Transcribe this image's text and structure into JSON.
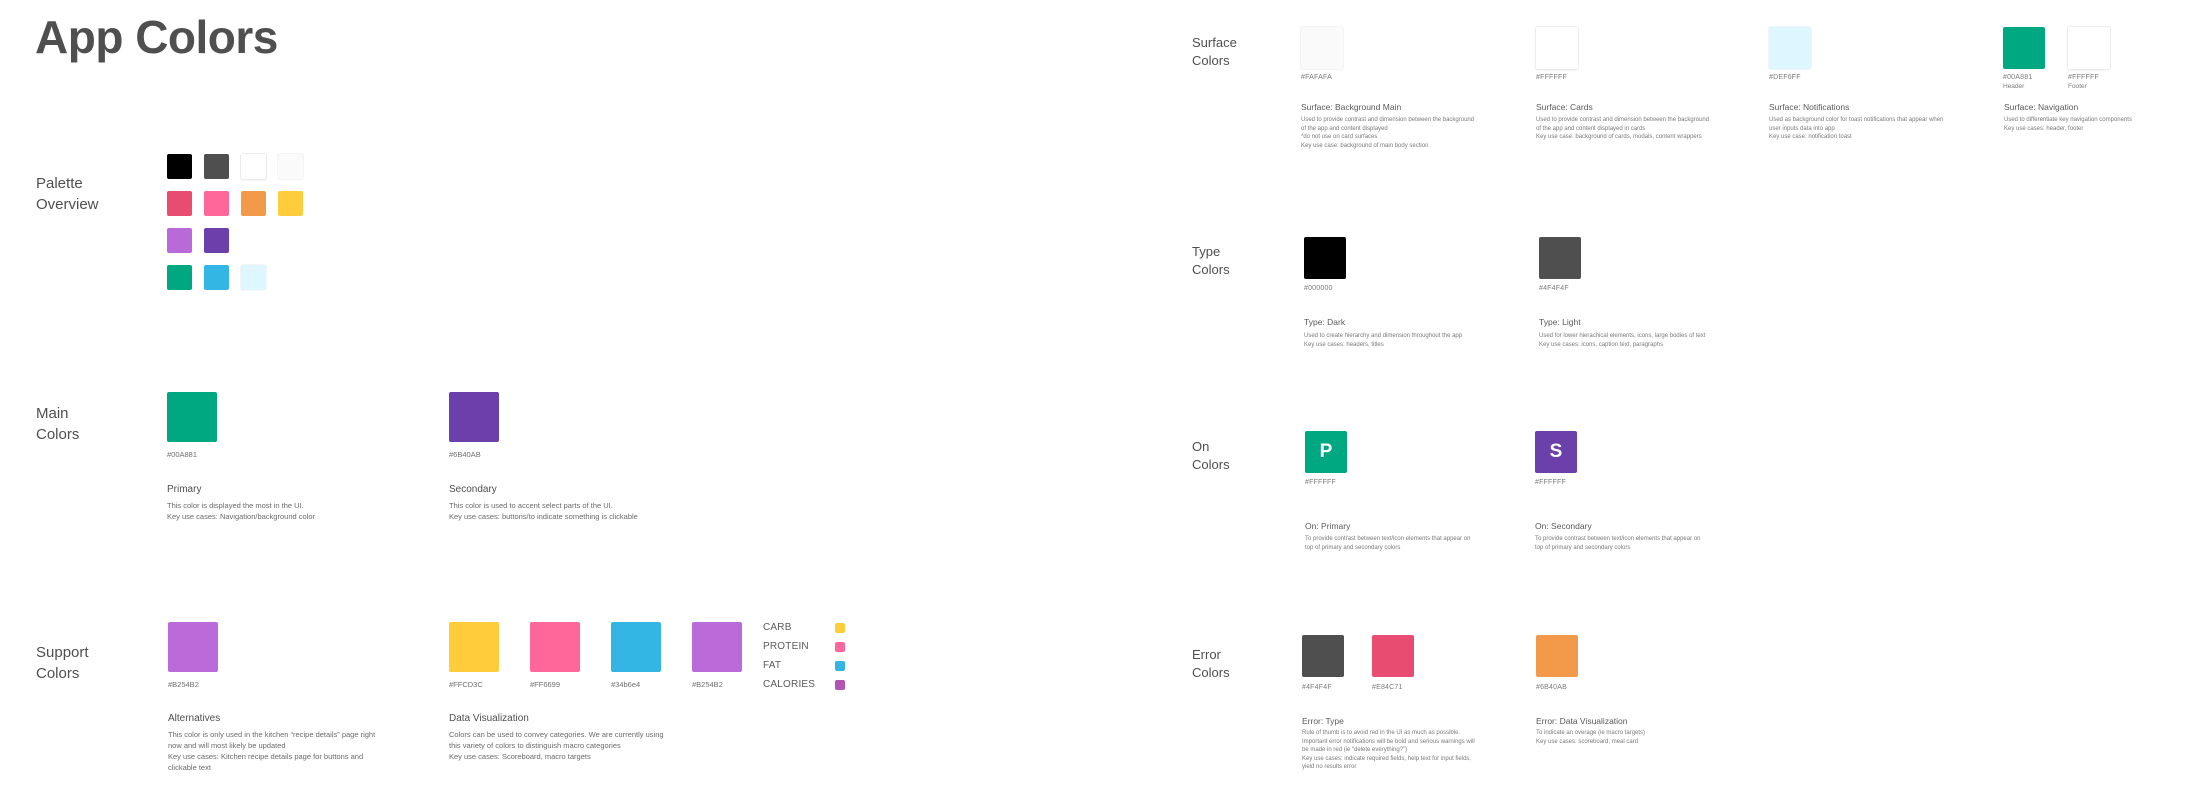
{
  "page": {
    "title": "App Colors"
  },
  "palette": {
    "label": [
      "Palette",
      "Overview"
    ],
    "rows": [
      [
        {
          "hex": "#000000"
        },
        {
          "hex": "#4F4F4F"
        },
        {
          "hex": "#FFFFFF"
        },
        {
          "hex": "#FAFAFA"
        }
      ],
      [
        {
          "hex": "#E84C71"
        },
        {
          "hex": "#FF6699"
        },
        {
          "hex": "#F39A4A"
        },
        {
          "hex": "#FFCD3C"
        }
      ],
      [
        {
          "hex": "#B86AD9"
        },
        {
          "hex": "#6B40AB"
        }
      ],
      [
        {
          "hex": "#00A881"
        },
        {
          "hex": "#34B6E4"
        },
        {
          "hex": "#DEF6FF"
        }
      ]
    ]
  },
  "main": {
    "label": [
      "Main",
      "Colors"
    ],
    "items": [
      {
        "hex_label": "#00A881",
        "color": "#00A881",
        "title": "Primary",
        "desc": [
          "This color is displayed the most in the UI.",
          "Key use cases: Navigation/background color"
        ]
      },
      {
        "hex_label": "#6B40AB",
        "color": "#6B40AB",
        "title": "Secondary",
        "desc": [
          "This color is used to accent select parts of the UI.",
          "Key use cases: buttons/to indicate something is clickable"
        ]
      }
    ]
  },
  "support": {
    "label": [
      "Support",
      "Colors"
    ],
    "alternatives": {
      "hex_label": "#B254B2",
      "color": "#BA6BD9",
      "title": "Alternatives",
      "desc": [
        "This color is only used in the kitchen “recipe details” page right",
        "now and will most likely be updated",
        "Key use cases: Kitchen recipe details page for buttons and",
        "clickable text"
      ]
    },
    "data_viz": {
      "swatches": [
        {
          "hex_label": "#FFCD3C",
          "color": "#FFCD3C"
        },
        {
          "hex_label": "#FF6699",
          "color": "#FF6699"
        },
        {
          "hex_label": "#34b6e4",
          "color": "#34B6E4"
        },
        {
          "hex_label": "#B254B2",
          "color": "#BA6BD9"
        }
      ],
      "legend": [
        {
          "label": "CARB",
          "color": "#FFCD3C"
        },
        {
          "label": "PROTEIN",
          "color": "#FF6699"
        },
        {
          "label": "FAT",
          "color": "#34B6E4"
        },
        {
          "label": "CALORIES",
          "color": "#B254B2"
        }
      ],
      "title": "Data Visualization",
      "desc": [
        "Colors can be used to convey categories. We are currently using",
        "this variety of colors to distinguish macro categories",
        "Key use cases: Scoreboard, macro targets"
      ]
    }
  },
  "surface": {
    "label": [
      "Surface",
      "Colors"
    ],
    "items": [
      {
        "hex_label": "#FAFAFA",
        "color": "#FAFAFA",
        "title": "Surface: Background Main",
        "desc": [
          "Used to provide contrast and dimension between the background",
          "of the app and content displayed",
          "*do not use on card surfaces",
          "Key use case: background of main body section"
        ]
      },
      {
        "hex_label": "#FFFFFF",
        "color": "#FFFFFF",
        "title": "Surface: Cards",
        "desc": [
          "Used to provide contrast and dimension between the background",
          "of the app and content displayed in cards",
          "Key use case: background of cards, modals, content wrappers"
        ]
      },
      {
        "hex_label": "#DEF6FF",
        "color": "#DEF6FF",
        "title": "Surface: Notifications",
        "desc": [
          "Used as background color for toast notifications that appear when",
          "user inputs data into app",
          "Key use case: notification toast"
        ]
      }
    ],
    "navigation": {
      "swatches": [
        {
          "hex_label": "#00A881",
          "sub": "Header",
          "color": "#00A881"
        },
        {
          "hex_label": "#FFFFFF",
          "sub": "Footer",
          "color": "#FFFFFF"
        }
      ],
      "title": "Surface: Navigation",
      "desc": [
        "Used to differentiate key navigation components",
        "Key use cases: header, footer"
      ]
    }
  },
  "type": {
    "label": [
      "Type",
      "Colors"
    ],
    "items": [
      {
        "hex_label": "#000000",
        "color": "#000000",
        "title": "Type: Dark",
        "desc": [
          "Used to create hierarchy and dimension throughout the app",
          "Key use cases: headers, titles"
        ]
      },
      {
        "hex_label": "#4F4F4F",
        "color": "#4F4F4F",
        "title": "Type: Light",
        "desc": [
          "Used for lower hierachical elements, icons,  large bodies of text",
          "Key use cases: icons, caption text, paragraphs"
        ]
      }
    ]
  },
  "on": {
    "label": [
      "On",
      "Colors"
    ],
    "items": [
      {
        "hex_label": "#FFFFFF",
        "color": "#00A881",
        "letter": "P",
        "title": "On: Primary",
        "desc": [
          "To provide contrast between text/icon elements that appear on",
          "top of primary and secondary colors"
        ]
      },
      {
        "hex_label": "#FFFFFF",
        "color": "#6B40AB",
        "letter": "S",
        "title": "On: Secondary",
        "desc": [
          "To provide contrast between text/icon elements that appear on",
          "top of primary and secondary colors"
        ]
      }
    ]
  },
  "error": {
    "label": [
      "Error",
      "Colors"
    ],
    "type": {
      "swatches": [
        {
          "hex_label": "#4F4F4F",
          "color": "#4F4F4F"
        },
        {
          "hex_label": "#E84C71",
          "color": "#E84C71"
        }
      ],
      "title": "Error: Type",
      "desc": [
        "Rule of thumb is to avoid red in the UI as much as possible.",
        "Important error notifications will be bold and serious warnings will",
        "be made in red (ie “delete everything?”)",
        "Key use cases: indicate required fields, help text for input fields,",
        "yield no results error"
      ]
    },
    "data_viz": {
      "swatches": [
        {
          "hex_label": "#6B40AB",
          "color": "#F39A4A"
        }
      ],
      "title": "Error: Data Visualization",
      "desc": [
        "To indicate an overage (ie macro targets)",
        "Key use cases: scoreboard, meal card"
      ]
    }
  }
}
